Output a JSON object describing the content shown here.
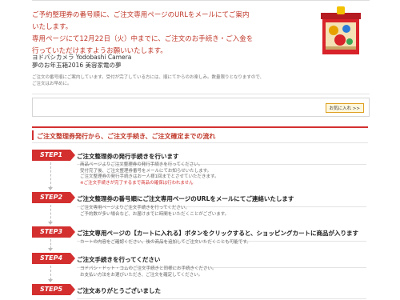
{
  "intro": {
    "line1": "ご予約整理券の番号順に、ご注文専用ページのURLをメールにてご案内",
    "line2": "いたします。",
    "line3": "専用ページにて12月22日（火）中までに、ご注文のお手続き・ご入金を",
    "line4": "行っていただけますようお願いいたします。"
  },
  "shop": {
    "name": "ヨドバシカメラ Yodobashi Camera",
    "product": "夢のお年玉箱2016 美容家電の夢"
  },
  "note": "ご注文の番号順にご案内しています。受付が完了している方には、順にてからのお楽しみ。数量限りとなりますので、ご注文はお早めに。",
  "cart": {
    "button": "お気に入れ >>"
  },
  "flow": {
    "title": "ご注文整理券発行から、ご注文手続き、ご注文確定までの流れ"
  },
  "steps": [
    {
      "tag": "STEP1",
      "head": "ご注文整理券の発行手続きを行います",
      "body1": "商品ページよりご注文整理券の発行手続きを行ってください。",
      "body2": "受付完了後、ご注文整理券番号をメールにてお知らせいたします。",
      "body3": "ご注文整理券の発行手続きはお一人様1回までとさせていただきます。",
      "warn": "※ご注文手続きが完了するまで商品の確保は行われません"
    },
    {
      "tag": "STEP2",
      "head": "ご注文整理券の番号順にご注文専用ページのURLをメールにてご連絡いたします",
      "body1": "ご注文専用ページよりご注文手続きを行ってください。",
      "body2": "ご予約数が多い場合など、お届けまでに時間をいただくことがございます。"
    },
    {
      "tag": "STEP3",
      "head": "ご注文専用ページの【カートに入れる】ボタンをクリックすると、ショッピングカートに商品が入ります",
      "body1": "カートの内容をご確認ください。後の商品を追加してご注文いただくことも可能です。"
    },
    {
      "tag": "STEP4",
      "head": "ご注文手続きを行ってください",
      "body1": "ヨドバシ・ドット・コムのご注文手続きと同様にお手続きください。",
      "body2": "お支払い方法をお選びいただき、ご注文を確定してください。"
    },
    {
      "tag": "STEP5",
      "head": "ご注文ありがとうございました"
    }
  ]
}
